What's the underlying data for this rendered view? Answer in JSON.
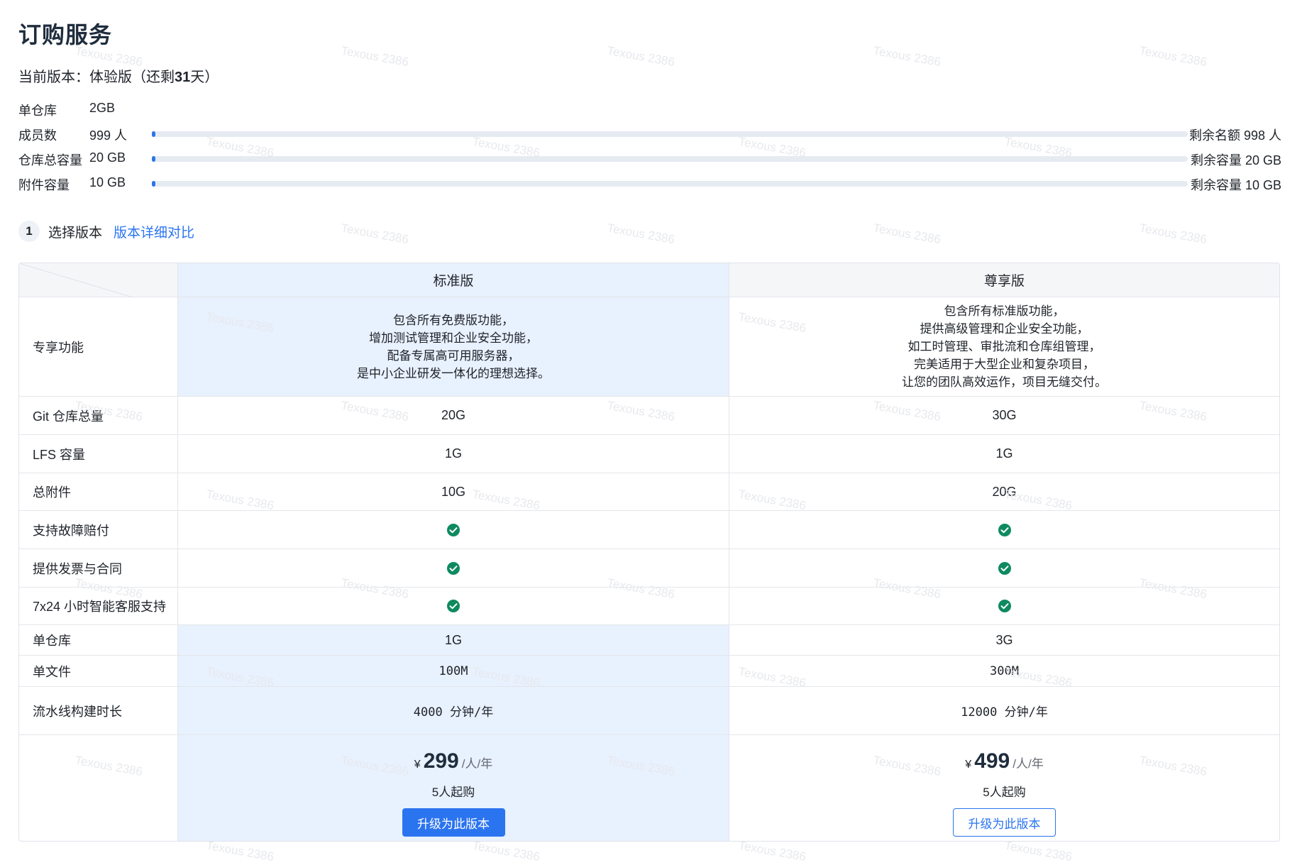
{
  "page": {
    "title": "订购服务",
    "current_version_label": "当前版本：",
    "current_version_value": "体验版（还剩",
    "current_version_days": "31",
    "current_version_suffix": "天）"
  },
  "quotas": [
    {
      "label": "单仓库",
      "value": "2GB",
      "remaining": "",
      "fill_fraction": null
    },
    {
      "label": "成员数",
      "value": "999 人",
      "remaining": "剩余名额 998 人",
      "fill_fraction": 0.003
    },
    {
      "label": "仓库总容量",
      "value": "20 GB",
      "remaining": "剩余容量 20 GB",
      "fill_fraction": 0.003
    },
    {
      "label": "附件容量",
      "value": "10 GB",
      "remaining": "剩余容量 10 GB",
      "fill_fraction": 0.003
    }
  ],
  "step": {
    "number": "1",
    "label": "选择版本",
    "compare_link": "版本详细对比"
  },
  "plans": {
    "standard": {
      "name": "标准版",
      "description": "包含所有免费版功能，\n增加测试管理和企业安全功能，\n配备专属高可用服务器，\n是中小企业研发一体化的理想选择。",
      "currency": "¥",
      "price": "299",
      "unit": "/人/年",
      "min_buy": "5人起购",
      "button": "升级为此版本"
    },
    "premium": {
      "name": "尊享版",
      "description": "包含所有标准版功能，\n提供高级管理和企业安全功能，\n如工时管理、审批流和仓库组管理，\n完美适用于大型企业和复杂项目，\n让您的团队高效运作，项目无缝交付。",
      "currency": "¥",
      "price": "499",
      "unit": "/人/年",
      "min_buy": "5人起购",
      "button": "升级为此版本"
    }
  },
  "feature_rows": [
    {
      "label": "专享功能"
    },
    {
      "label": "Git 仓库总量",
      "standard": "20G",
      "premium": "30G"
    },
    {
      "label": "LFS 容量",
      "standard": "1G",
      "premium": "1G"
    },
    {
      "label": "总附件",
      "standard": "10G",
      "premium": "20G"
    },
    {
      "label": "支持故障赔付",
      "standard": "check",
      "premium": "check"
    },
    {
      "label": "提供发票与合同",
      "standard": "check",
      "premium": "check"
    },
    {
      "label": "7x24 小时智能客服支持",
      "standard": "check",
      "premium": "check"
    },
    {
      "label": "单仓库",
      "standard": "1G",
      "premium": "3G"
    },
    {
      "label": "单文件",
      "standard": "100M",
      "premium": "300M"
    },
    {
      "label": "流水线构建时长",
      "standard": "4000 分钟/年",
      "premium": "12000 分钟/年"
    }
  ],
  "icons": {
    "included": "check-circle-icon"
  },
  "colors": {
    "accent": "#2b74f0",
    "check": "#0e8a5f",
    "highlight": "#e8f1fe"
  },
  "watermark": "Texous 2386"
}
